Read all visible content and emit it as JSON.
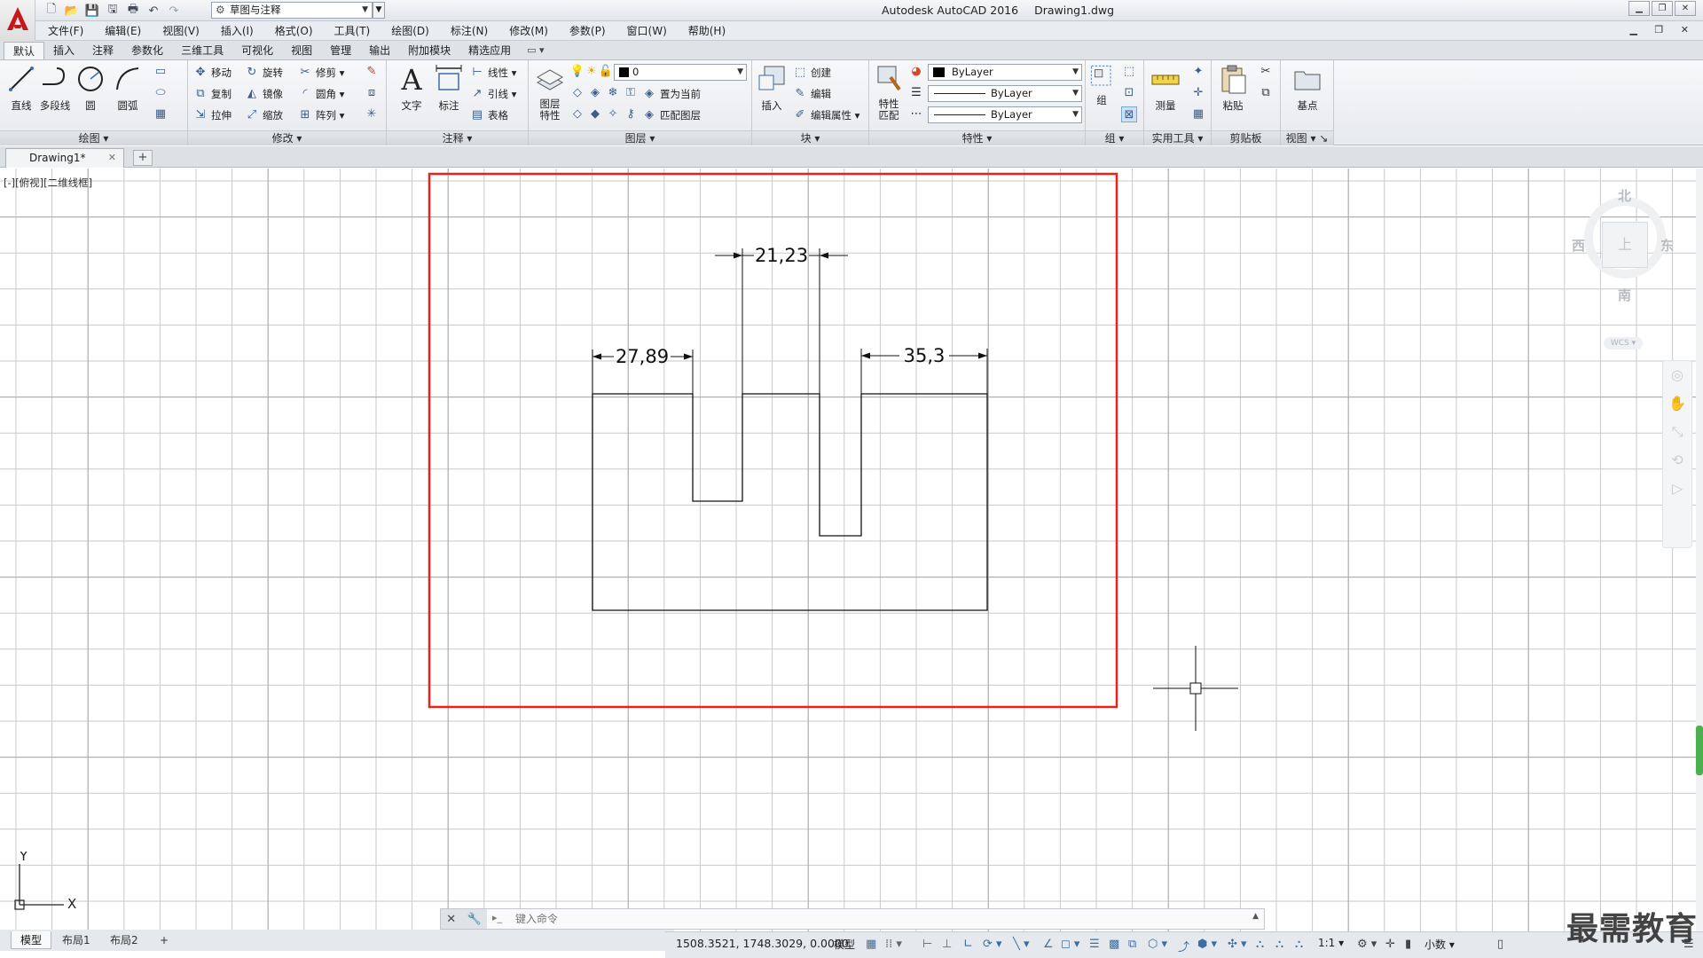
{
  "app": {
    "title": "Autodesk AutoCAD 2016",
    "document": "Drawing1.dwg"
  },
  "quick_access": {
    "workspace": "草图与注释"
  },
  "menu": [
    "文件(F)",
    "编辑(E)",
    "视图(V)",
    "插入(I)",
    "格式(O)",
    "工具(T)",
    "绘图(D)",
    "标注(N)",
    "修改(M)",
    "参数(P)",
    "窗口(W)",
    "帮助(H)"
  ],
  "ribbon_tabs": [
    "默认",
    "插入",
    "注释",
    "参数化",
    "三维工具",
    "可视化",
    "视图",
    "管理",
    "输出",
    "附加模块",
    "精选应用"
  ],
  "ribbon": {
    "draw": {
      "title": "绘图",
      "line": "直线",
      "polyline": "多段线",
      "circle": "圆",
      "arc": "圆弧"
    },
    "modify": {
      "title": "修改",
      "move": "移动",
      "rotate": "旋转",
      "trim": "修剪",
      "copy": "复制",
      "mirror": "镜像",
      "fillet": "圆角",
      "stretch": "拉伸",
      "scale": "缩放",
      "array": "阵列"
    },
    "annotation": {
      "title": "注释",
      "text": "文字",
      "dimension": "标注",
      "linear": "线性",
      "leader": "引线",
      "table": "表格"
    },
    "layers": {
      "title": "图层",
      "layer_props": "图层特性",
      "current_layer": "0",
      "set_current": "置为当前",
      "match_layer": "匹配图层"
    },
    "block": {
      "title": "块",
      "insert": "插入",
      "create": "创建",
      "edit": "编辑",
      "edit_attr": "编辑属性"
    },
    "properties": {
      "title": "特性",
      "match": "特性匹配",
      "color": "ByLayer",
      "linetype": "ByLayer",
      "lineweight": "ByLayer"
    },
    "groups": {
      "title": "组",
      "group": "组"
    },
    "utilities": {
      "title": "实用工具",
      "measure": "测量"
    },
    "clipboard": {
      "title": "剪贴板",
      "paste": "粘贴"
    },
    "view": {
      "title": "视图",
      "base": "基点"
    }
  },
  "file_tab": {
    "name": "Drawing1*"
  },
  "viewport": {
    "label": "[-][俯视][二维线框]",
    "compass": {
      "north": "北",
      "south": "南",
      "east": "东",
      "west": "西",
      "wcs": "WCS"
    },
    "ucs": {
      "x": "X",
      "y": "Y"
    }
  },
  "dimensions": {
    "left_width": "27,89",
    "slot_width": "21,23",
    "right_width": "35,3"
  },
  "command_line": {
    "placeholder": "键入命令"
  },
  "layout_tabs": [
    "模型",
    "布局1",
    "布局2"
  ],
  "status": {
    "coordinates": "1508.3521, 1748.3029, 0.0000",
    "model": "模型",
    "scale": "1:1",
    "units": "小数"
  },
  "watermark": "最需教育",
  "colors": {
    "highlight_box": "#e8231d",
    "accent": "#3a6ea5",
    "grid": "#c9c9c9"
  }
}
